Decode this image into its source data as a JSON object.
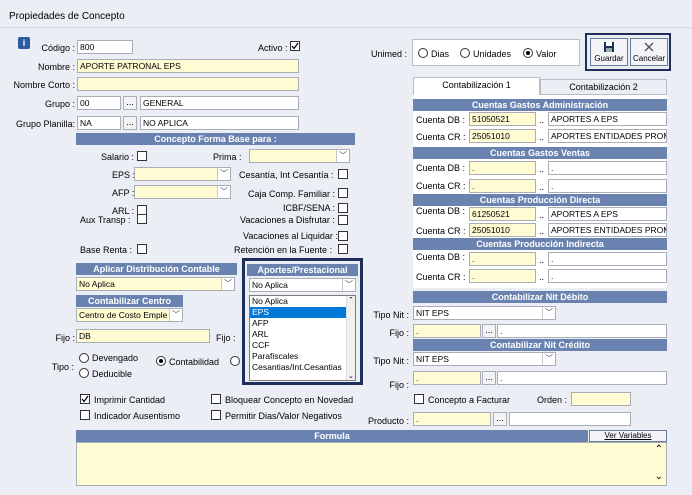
{
  "window": {
    "title": "Propiedades de Concepto"
  },
  "info_icon": "info-icon",
  "codigo": {
    "label": "Código :",
    "value": "800"
  },
  "activo": {
    "label": "Activo :",
    "checked": true
  },
  "nombre": {
    "label": "Nombre :",
    "value": "APORTE PATRONAL EPS"
  },
  "nombre_corto": {
    "label": "Nombre Corto :",
    "value": ""
  },
  "grupo": {
    "label": "Grupo :",
    "code": "00",
    "dots": "...",
    "name": "GENERAL"
  },
  "grupo_planilla": {
    "label": "Grupo Planilla:",
    "code": "NA",
    "dots": "...",
    "name": "NO APLICA"
  },
  "unimed": {
    "label": "Unimed :",
    "options": [
      "Dias",
      "Unidades",
      "Valor"
    ],
    "selected": "Valor"
  },
  "toolbar": {
    "save_label": "Guardar",
    "cancel_label": "Cancelar"
  },
  "forma_base": {
    "header": "Concepto Forma Base para :",
    "salario": "Salario :",
    "prima": "Prima :",
    "eps": "EPS :",
    "cesantia": "Cesantía, Int Cesantía :",
    "afp": "AFP :",
    "caja": "Caja Comp. Familiar :",
    "arl": "ARL :",
    "icbf": "ICBF/SENA :",
    "aux": "Aux Transp :",
    "vac_disfrutar": "Vacaciones a Disfrutar :",
    "vac_liquidar": "Vacaciones al Liquidar :",
    "base_renta": "Base Renta :",
    "retencion": "Retención en la Fuente :"
  },
  "distribucion": {
    "header": "Aplicar Distribución Contable",
    "value": "No Aplica"
  },
  "aportes": {
    "header": "Aportes/Prestacional",
    "value": "No Aplica",
    "options": [
      "No Aplica",
      "EPS",
      "AFP",
      "ARL",
      "CCF",
      "Parafiscales",
      "Cesantias/Int.Cesantias"
    ],
    "highlighted": "EPS"
  },
  "centro": {
    "header": "Contabilizar Centro",
    "value": "Centro de Costo Emple"
  },
  "fijo_left": {
    "label": "Fijo :",
    "value": "DB",
    "label2": "Fijo :"
  },
  "tipo": {
    "label": "Tipo :",
    "devengado": "Devengado",
    "deducible": "Deducible",
    "contabilidad": "Contabilidad",
    "selected": "Contabilidad"
  },
  "options_bottom": {
    "imprimir": {
      "label": "Imprimir Cantidad",
      "checked": true
    },
    "ausentismo": {
      "label": "Indicador Ausentismo",
      "checked": false
    },
    "bloquear": {
      "label": "Bloquear Concepto en Novedad",
      "checked": false
    },
    "permitir": {
      "label": "Permitir Dias/Valor Negativos",
      "checked": false
    }
  },
  "formula": {
    "header": "Formula",
    "ver_variables": "Ver Variables"
  },
  "tabs": [
    {
      "label": "Contabilización 1"
    },
    {
      "label": "Contabilización 2"
    }
  ],
  "gastos_admin": {
    "header": "Cuentas Gastos Administración",
    "db_label": "Cuenta DB :",
    "db_code": "51050521",
    "db_name": "APORTES A EPS",
    "cr_label": "Cuenta CR :",
    "cr_code": "25051010",
    "cr_name": "APORTES ENTIDADES PROM"
  },
  "gastos_ventas": {
    "header": "Cuentas Gastos Ventas",
    "db_label": "Cuenta DB :",
    "db_code": ".",
    "db_name": ".",
    "cr_label": "Cuenta CR :",
    "cr_code": ".",
    "cr_name": "."
  },
  "produccion_directa": {
    "header": "Cuentas Producción Directa",
    "db_label": "Cuenta DB :",
    "db_code": "61250521",
    "db_name": "APORTES A EPS",
    "cr_label": "Cuenta CR :",
    "cr_code": "25051010",
    "cr_name": "APORTES ENTIDADES PROM"
  },
  "produccion_indirecta": {
    "header": "Cuentas Producción Indirecta",
    "db_label": "Cuenta DB :",
    "db_code": ".",
    "db_name": ".",
    "cr_label": "Cuenta CR :",
    "cr_code": ".",
    "cr_name": "."
  },
  "nit_debito": {
    "header": "Contabilizar Nit Débito",
    "tipo_label": "Tipo Nit :",
    "tipo_value": "NIT EPS",
    "fijo_label": "Fijo :",
    "fijo_value": ".",
    "dots": "...",
    "fijo_name": "."
  },
  "nit_credito": {
    "header": "Contabilizar Nit Crédito",
    "tipo_label": "Tipo Nit :",
    "tipo_value": "NIT EPS",
    "fijo_label": "Fijo :",
    "fijo_value": ".",
    "dots": "...",
    "fijo_name": "."
  },
  "concepto_facturar": {
    "label": "Concepto a Facturar",
    "orden_label": "Orden :",
    "orden_value": ""
  },
  "producto": {
    "label": "Producto :",
    "value": ".",
    "dots": "...",
    "name": ""
  },
  "colors": {
    "header_bg": "#6a82b0",
    "field_bg": "#fffbd2",
    "window_bg": "#ebeef5",
    "highlight": "#0078d7",
    "frame": "#1e2f5c"
  }
}
